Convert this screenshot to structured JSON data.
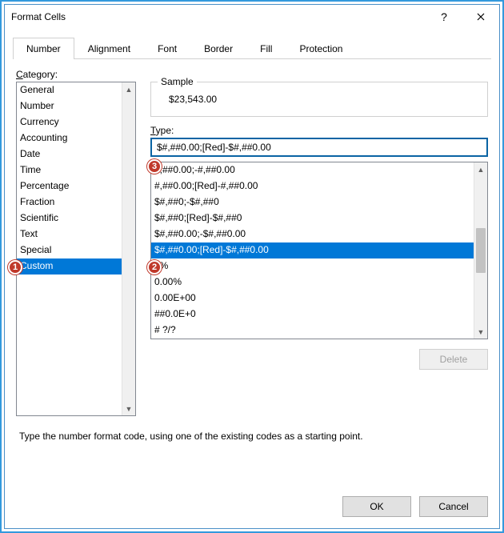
{
  "window": {
    "title": "Format Cells",
    "help": "?",
    "close": "✕"
  },
  "tabs": {
    "items": [
      "Number",
      "Alignment",
      "Font",
      "Border",
      "Fill",
      "Protection"
    ],
    "active_index": 0
  },
  "category": {
    "label": "Category:",
    "items": [
      "General",
      "Number",
      "Currency",
      "Accounting",
      "Date",
      "Time",
      "Percentage",
      "Fraction",
      "Scientific",
      "Text",
      "Special",
      "Custom"
    ],
    "selected_index": 11
  },
  "sample": {
    "label": "Sample",
    "value": "$23,543.00"
  },
  "type": {
    "label": "Type:",
    "input_value": "$#,##0.00;[Red]-$#,##0.00",
    "list": [
      "#,##0.00;-#,##0.00",
      "#,##0.00;[Red]-#,##0.00",
      "$#,##0;-$#,##0",
      "$#,##0;[Red]-$#,##0",
      "$#,##0.00;-$#,##0.00",
      "$#,##0.00;[Red]-$#,##0.00",
      "0%",
      "0.00%",
      "0.00E+00",
      "##0.0E+0",
      "# ?/?"
    ],
    "selected_index": 5
  },
  "buttons": {
    "delete": "Delete",
    "ok": "OK",
    "cancel": "Cancel"
  },
  "hint": "Type the number format code, using one of the existing codes as a starting point.",
  "callouts": {
    "c1": "1",
    "c2": "2",
    "c3": "3"
  }
}
